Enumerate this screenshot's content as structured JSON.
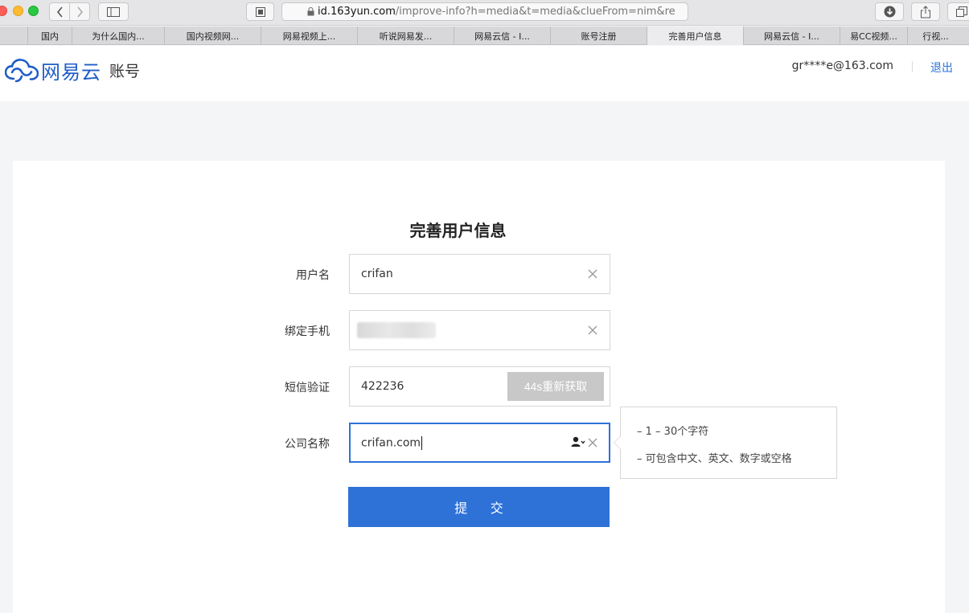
{
  "browser": {
    "url_host": "id.163yun.com",
    "url_path": "/improve-info?h=media&t=media&clueFrom=nim&referrer=ht",
    "tabs": [
      {
        "label": "国内"
      },
      {
        "label": "为什么国内..."
      },
      {
        "label": "国内视频网..."
      },
      {
        "label": "网易视频上..."
      },
      {
        "label": "听说网易发..."
      },
      {
        "label": "网易云信 - I..."
      },
      {
        "label": "账号注册"
      },
      {
        "label": "完善用户信息",
        "active": true
      },
      {
        "label": "网易云信 - I..."
      },
      {
        "label": "易CC视频..."
      },
      {
        "label": "行视..."
      }
    ]
  },
  "header": {
    "logo_text": "网易云",
    "logo_sub": "账号",
    "user_email": "gr****e@163.com",
    "logout_label": "退出",
    "brand_color": "#1f5dc8"
  },
  "form": {
    "title": "完善用户信息",
    "username": {
      "label": "用户名",
      "value": "crifan"
    },
    "phone": {
      "label": "绑定手机"
    },
    "sms": {
      "label": "短信验证",
      "value": "422236",
      "resend_label": "44s重新获取"
    },
    "company": {
      "label": "公司名称",
      "value": "crifan.com"
    },
    "submit_label": "提 交",
    "accent_color": "#2e72d8"
  },
  "tooltip": {
    "rules": [
      "– 1 – 30个字符",
      "– 可包含中文、英文、数字或空格"
    ]
  }
}
